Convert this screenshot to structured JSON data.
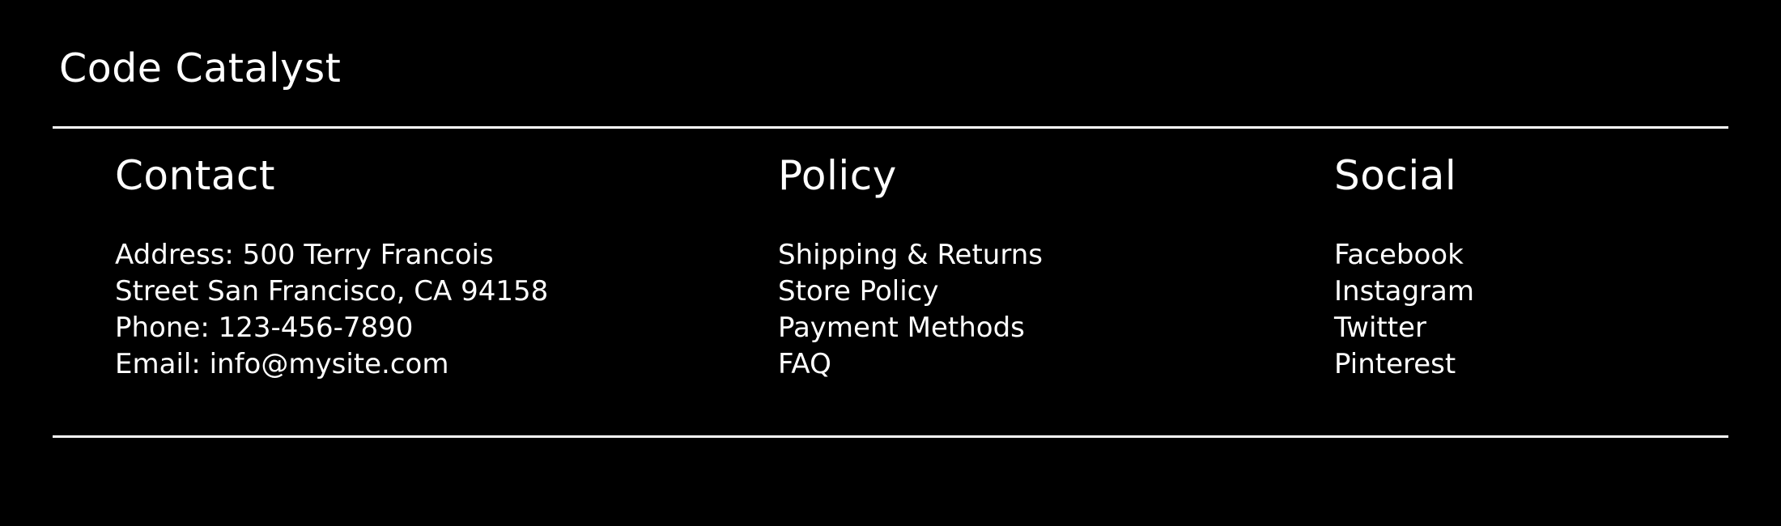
{
  "header": {
    "site_title": "Code Catalyst"
  },
  "footer": {
    "contact": {
      "heading": "Contact",
      "lines": [
        "Address: 500 Terry Francois",
        "Street San Francisco, CA 94158",
        "Phone: 123-456-7890",
        "Email: info@mysite.com"
      ]
    },
    "policy": {
      "heading": "Policy",
      "links": [
        "Shipping & Returns",
        "Store Policy",
        "Payment Methods",
        "FAQ"
      ]
    },
    "social": {
      "heading": "Social",
      "links": [
        "Facebook",
        "Instagram",
        "Twitter",
        "Pinterest"
      ]
    }
  },
  "colors": {
    "background": "#000000",
    "text": "#ffffff",
    "divider": "#ffffff"
  }
}
